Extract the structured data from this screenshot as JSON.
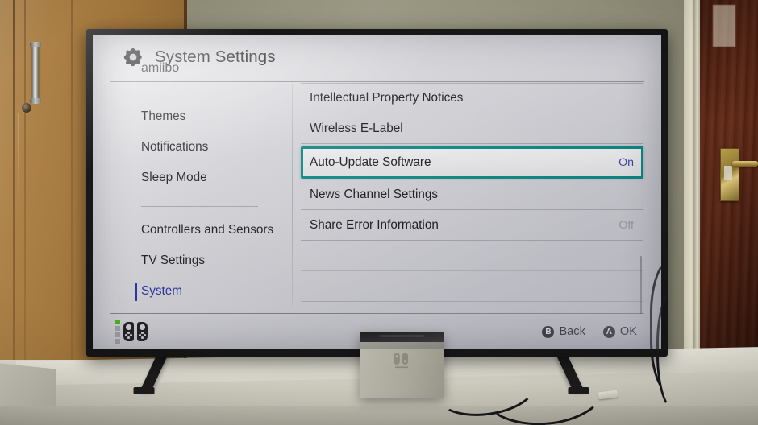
{
  "header": {
    "title": "System Settings",
    "icon": "gear-icon"
  },
  "sidebar": {
    "clipped_top_item": "amiibo",
    "group_one": [
      {
        "label": "Themes",
        "selected": false
      },
      {
        "label": "Notifications",
        "selected": false
      },
      {
        "label": "Sleep Mode",
        "selected": false
      }
    ],
    "group_two": [
      {
        "label": "Controllers and Sensors",
        "selected": false
      },
      {
        "label": "TV Settings",
        "selected": false
      },
      {
        "label": "System",
        "selected": true
      }
    ]
  },
  "main": {
    "rows": [
      {
        "label": "Intellectual Property Notices",
        "value": "",
        "selected": false
      },
      {
        "label": "Wireless E-Label",
        "value": "",
        "selected": false
      },
      {
        "label": "Auto-Update Software",
        "value": "On",
        "selected": true
      },
      {
        "label": "News Channel Settings",
        "value": "",
        "selected": false
      },
      {
        "label": "Share Error Information",
        "value": "Off",
        "selected": false
      }
    ]
  },
  "bottom_bar": {
    "controller": {
      "player_leds": [
        "on",
        "off",
        "off",
        "off"
      ],
      "joycon_left": "joycon-left-icon",
      "joycon_right": "joycon-right-icon"
    },
    "actions": [
      {
        "badge": "B",
        "label": "Back"
      },
      {
        "badge": "A",
        "label": "OK"
      }
    ]
  },
  "colors": {
    "selection_border": "#0c8a86",
    "selected_text": "#2a35a4",
    "value_on": "#3b49a2",
    "value_off": "#9a9aa3",
    "led_on": "#4ac219",
    "ui_background": "#d9d9de"
  }
}
